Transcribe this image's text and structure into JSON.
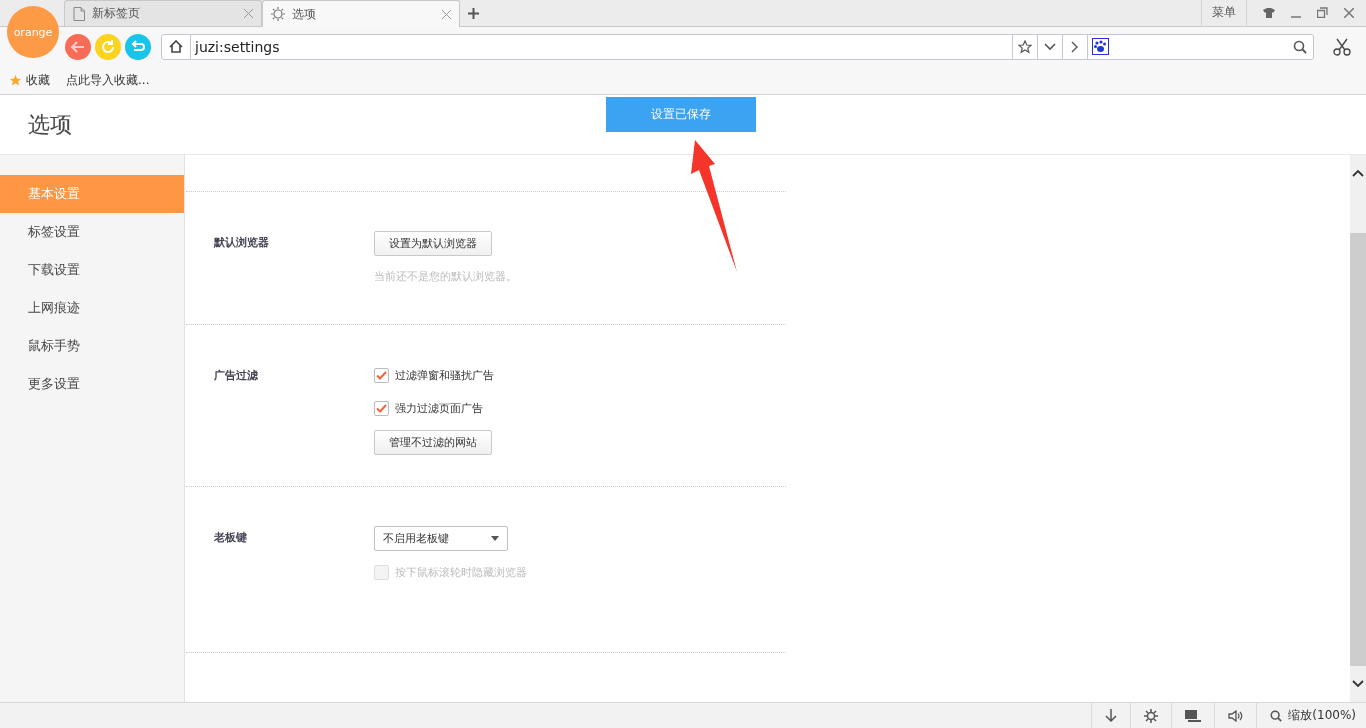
{
  "browser": {
    "logo": "orange",
    "tabs": [
      {
        "label": "新标签页",
        "kind": "page",
        "selected": false
      },
      {
        "label": "选项",
        "kind": "settings",
        "selected": true
      }
    ],
    "menu": "菜单",
    "address": "juzi:settings",
    "bookmarks": [
      "收藏",
      "点此导入收藏..."
    ]
  },
  "page": {
    "title": "选项",
    "saved_button": "设置已保存"
  },
  "sidebar": {
    "items": [
      {
        "label": "基本设置",
        "selected": true
      },
      {
        "label": "标签设置",
        "selected": false
      },
      {
        "label": "下载设置",
        "selected": false
      },
      {
        "label": "上网痕迹",
        "selected": false
      },
      {
        "label": "鼠标手势",
        "selected": false
      },
      {
        "label": "更多设置",
        "selected": false
      }
    ]
  },
  "sections": [
    {
      "kind": "button",
      "label": "默认浏览器",
      "button": "设置为默认浏览器",
      "note": "当前还不是您的默认浏览器。"
    },
    {
      "kind": "checks",
      "label": "广告过滤",
      "options": [
        {
          "label": "过滤弹窗和骚扰广告",
          "checked": true,
          "disabled": false
        },
        {
          "label": "强力过滤页面广告",
          "checked": true,
          "disabled": false
        }
      ],
      "button": "管理不过滤的网站"
    },
    {
      "kind": "select",
      "label": "老板键",
      "value": "不启用老板键",
      "options": [
        {
          "label": "按下鼠标滚轮时隐藏浏览器",
          "checked": false,
          "disabled": true
        }
      ]
    }
  ],
  "status_bar": {
    "zoom": "缩放(100%)"
  }
}
